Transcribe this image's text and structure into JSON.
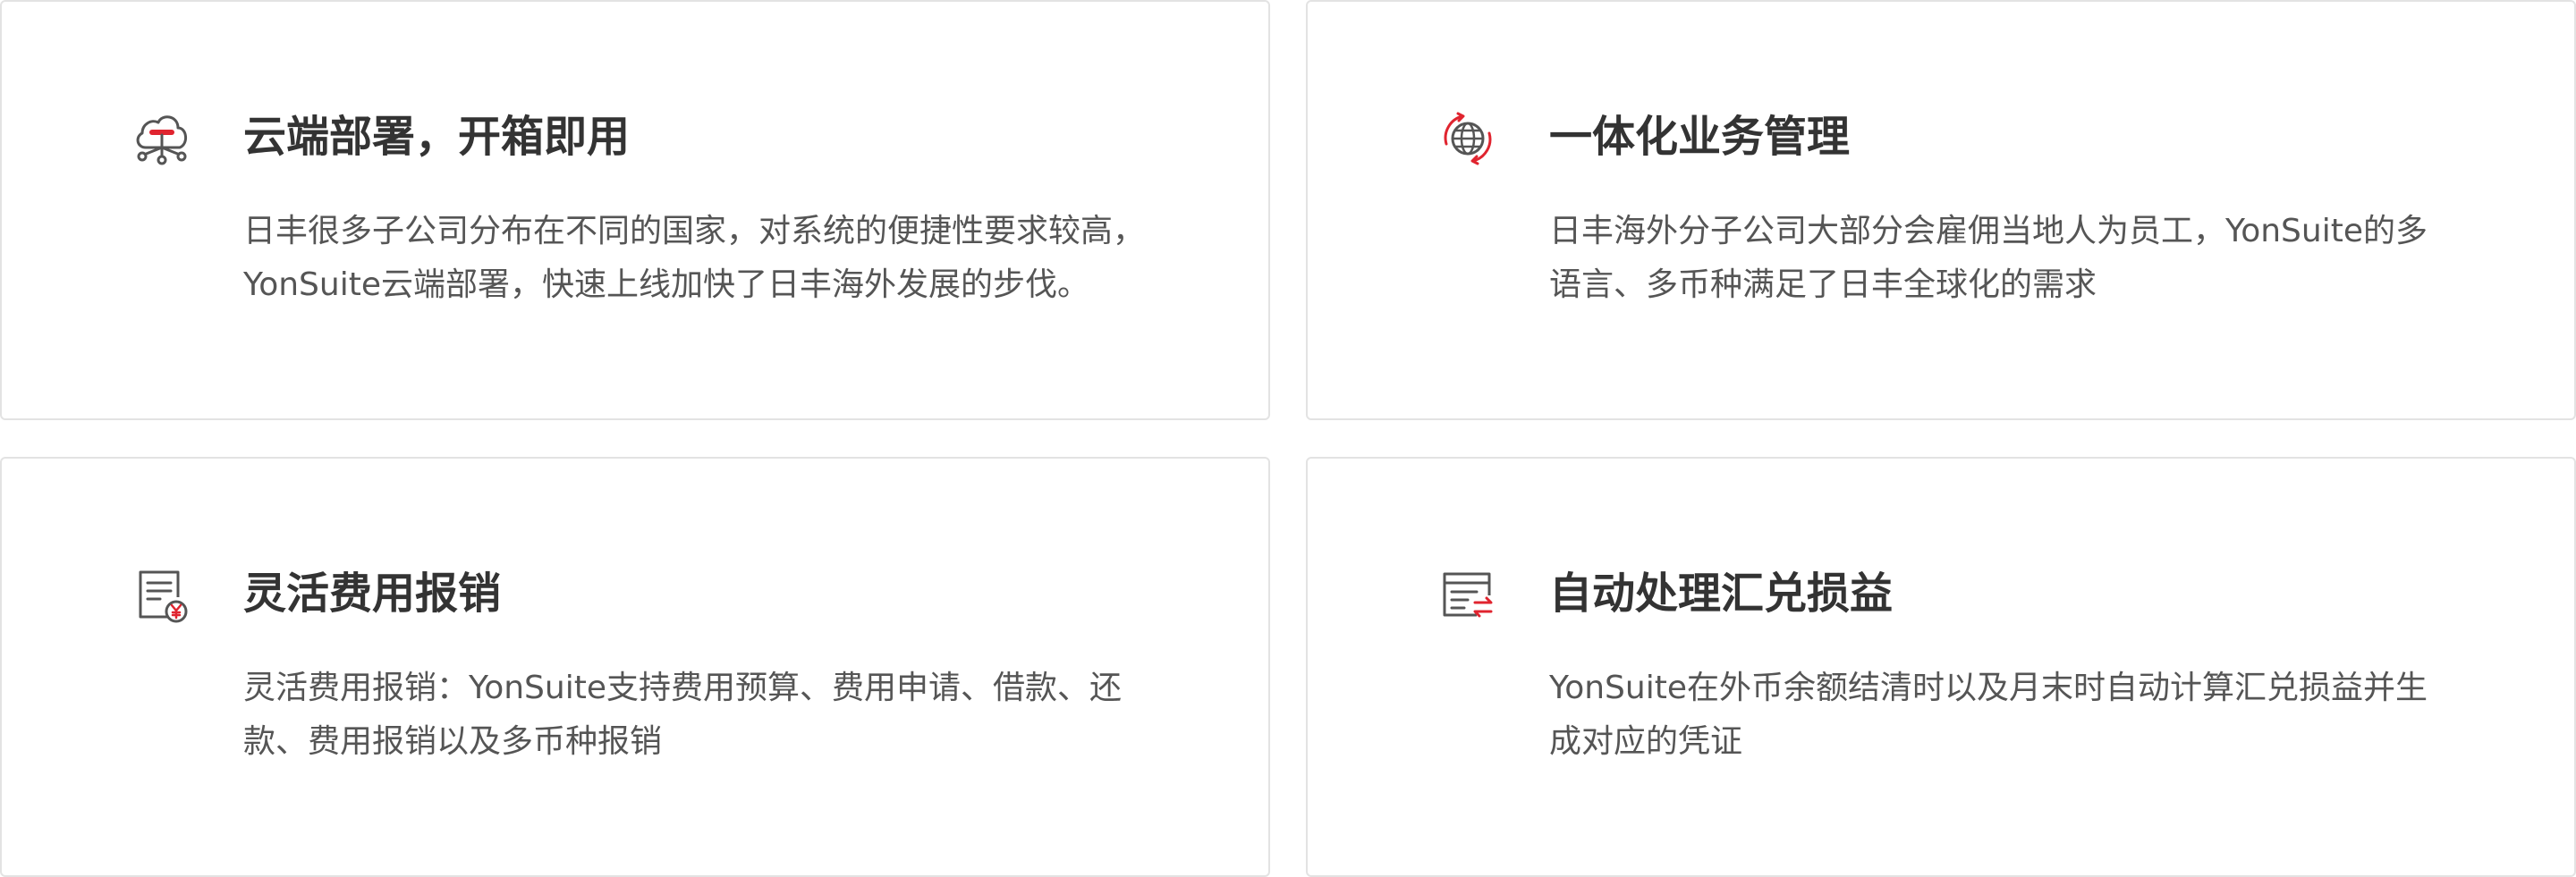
{
  "colors": {
    "accent": "#e0242f",
    "icon_stroke": "#555555",
    "title": "#333333",
    "text": "#555555",
    "card_border": "#e3e3e3"
  },
  "cards": [
    {
      "icon": "cloud-deploy-icon",
      "title": "云端部署，开箱即用",
      "description": "日丰很多子公司分布在不同的国家，对系统的便捷性要求较高，YonSuite云端部署，快速上线加快了日丰海外发展的步伐。"
    },
    {
      "icon": "globe-refresh-icon",
      "title": "一体化业务管理",
      "description": "日丰海外分子公司大部分会雇佣当地人为员工，YonSuite的多语言、多币种满足了日丰全球化的需求"
    },
    {
      "icon": "expense-document-icon",
      "title": "灵活费用报销",
      "description": "灵活费用报销：YonSuite支持费用预算、费用申请、借款、还款、费用报销以及多币种报销"
    },
    {
      "icon": "exchange-window-icon",
      "title": "自动处理汇兑损益",
      "description": "YonSuite在外币余额结清时以及月末时自动计算汇兑损益并生成对应的凭证"
    }
  ]
}
